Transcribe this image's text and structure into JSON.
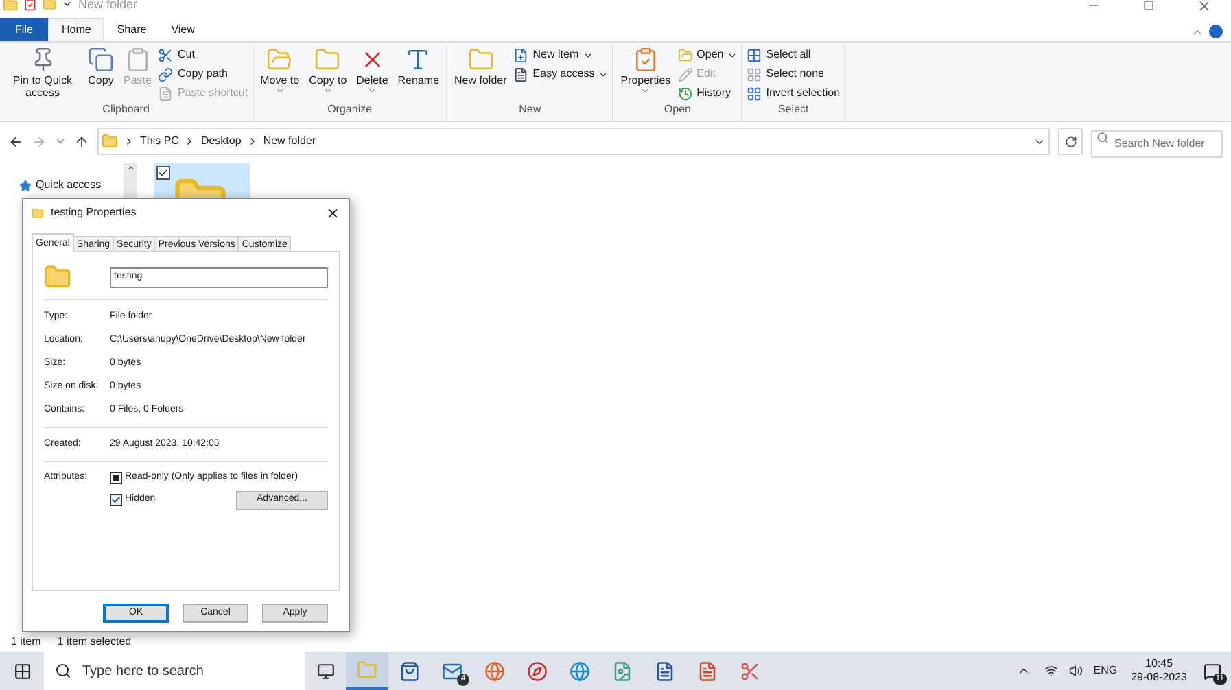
{
  "window": {
    "title": "New folder"
  },
  "ribbon_tabs": [
    {
      "label": "File",
      "kind": "file",
      "selected": false
    },
    {
      "label": "Home",
      "kind": "tab",
      "selected": true
    },
    {
      "label": "Share",
      "kind": "tab",
      "selected": false
    },
    {
      "label": "View",
      "kind": "tab",
      "selected": false
    }
  ],
  "ribbon_groups": [
    {
      "label": "Clipboard",
      "items": [
        {
          "kind": "large",
          "label": "Pin to Quick access",
          "disabled": false,
          "menu": false
        },
        {
          "kind": "large",
          "label": "Copy",
          "disabled": false,
          "menu": false
        },
        {
          "kind": "large",
          "label": "Paste",
          "disabled": true,
          "menu": false
        },
        {
          "kind": "small",
          "label": "Cut",
          "disabled": false,
          "menu": false
        },
        {
          "kind": "small",
          "label": "Copy path",
          "disabled": false,
          "menu": false
        },
        {
          "kind": "small",
          "label": "Paste shortcut",
          "disabled": true,
          "menu": false
        }
      ]
    },
    {
      "label": "Organize",
      "items": [
        {
          "kind": "large",
          "label": "Move to",
          "disabled": false,
          "menu": true
        },
        {
          "kind": "large",
          "label": "Copy to",
          "disabled": false,
          "menu": true
        },
        {
          "kind": "large",
          "label": "Delete",
          "disabled": false,
          "menu": true
        },
        {
          "kind": "large",
          "label": "Rename",
          "disabled": false,
          "menu": false
        }
      ]
    },
    {
      "label": "New",
      "items": [
        {
          "kind": "large",
          "label": "New folder",
          "disabled": false,
          "menu": false
        },
        {
          "kind": "small",
          "label": "New item",
          "disabled": false,
          "menu": true
        },
        {
          "kind": "small",
          "label": "Easy access",
          "disabled": false,
          "menu": true
        }
      ]
    },
    {
      "label": "Open",
      "items": [
        {
          "kind": "large",
          "label": "Properties",
          "disabled": false,
          "menu": true
        },
        {
          "kind": "small",
          "label": "Open",
          "disabled": false,
          "menu": true
        },
        {
          "kind": "small",
          "label": "Edit",
          "disabled": true,
          "menu": false
        },
        {
          "kind": "small",
          "label": "History",
          "disabled": false,
          "menu": false
        }
      ]
    },
    {
      "label": "Select",
      "items": [
        {
          "kind": "small",
          "label": "Select all",
          "disabled": false,
          "menu": false
        },
        {
          "kind": "small",
          "label": "Select none",
          "disabled": false,
          "menu": false
        },
        {
          "kind": "small",
          "label": "Invert selection",
          "disabled": false,
          "menu": false
        }
      ]
    }
  ],
  "address": {
    "path": [
      "This PC",
      "Desktop",
      "New folder"
    ],
    "search_placeholder": "Search New folder"
  },
  "navigation": {
    "items": [
      {
        "label": "Quick access"
      }
    ]
  },
  "files": [
    {
      "selected": true,
      "checked": true
    }
  ],
  "dialog": {
    "title": "testing Properties",
    "tabs": [
      {
        "label": "General",
        "selected": true
      },
      {
        "label": "Sharing",
        "selected": false
      },
      {
        "label": "Security",
        "selected": false
      },
      {
        "label": "Previous Versions",
        "selected": false
      },
      {
        "label": "Customize",
        "selected": false
      }
    ],
    "name_value": "testing",
    "sections": [
      [
        {
          "label": "Type:",
          "value": "File folder"
        },
        {
          "label": "Location:",
          "value": "C:\\Users\\anupy\\OneDrive\\Desktop\\New folder"
        },
        {
          "label": "Size:",
          "value": "0 bytes"
        },
        {
          "label": "Size on disk:",
          "value": "0 bytes"
        },
        {
          "label": "Contains:",
          "value": "0 Files, 0 Folders"
        }
      ],
      [
        {
          "label": "Created:",
          "value": "29 August 2023, 10:42:05"
        }
      ]
    ],
    "attributes_label": "Attributes:",
    "attributes": [
      {
        "label": "Read-only (Only applies to files in folder)",
        "checked": false,
        "indeterminate": true
      },
      {
        "label": "Hidden",
        "checked": true,
        "indeterminate": false
      }
    ],
    "advanced_button": "Advanced...",
    "buttons": [
      {
        "label": "OK",
        "default": true
      },
      {
        "label": "Cancel",
        "default": false
      },
      {
        "label": "Apply",
        "default": false
      }
    ]
  },
  "status_bar": {
    "count": "1 item",
    "selection": "1 item selected"
  },
  "taskbar": {
    "search_placeholder": "Type here to search",
    "apps": [
      {
        "running": true
      },
      {
        "running": false
      },
      {
        "running": false,
        "badge": "4"
      },
      {
        "running": false
      },
      {
        "running": false
      },
      {
        "running": false
      },
      {
        "running": false
      },
      {
        "running": false
      },
      {
        "running": false
      },
      {
        "running": false
      }
    ],
    "language": "ENG",
    "time": "10:45",
    "date": "29-08-2023",
    "notifications": "11"
  }
}
